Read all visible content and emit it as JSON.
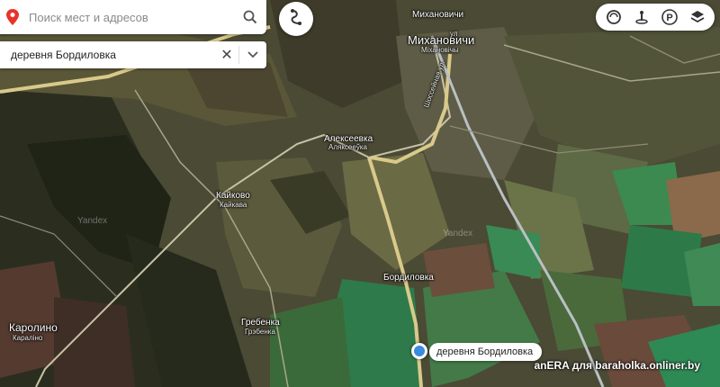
{
  "search": {
    "placeholder": "Поиск мест и адресов",
    "route_value": "деревня Бордиловка"
  },
  "colors": {
    "pin": "#e8332a",
    "marker": "#3b8bde",
    "road_major": "#d9c98a",
    "railway": "#b9c0c4"
  },
  "toolbar": {
    "icons": [
      "traffic-icon",
      "panorama-icon",
      "parking-icon",
      "layers-icon"
    ],
    "parking_letter": "P"
  },
  "places": {
    "mikhanovichi_top": "Михановичи",
    "mikhanovichi_big": "Михановичи",
    "mikhanovichi_by": "Міхановічы",
    "alekseevka": "Алексеевка",
    "alekseevka_by": "Аляксееўка",
    "kaykovo": "Кайково",
    "kaykovo_by": "Кайкава",
    "bordilovka": "Бордиловка",
    "grebenka": "Гребенка",
    "grebenka_by": "Грэбенка",
    "karolino": "Каролино",
    "karolino_by": "Каралiно",
    "street_top": "ул",
    "street_shosseynaya": "Шоссейная ул."
  },
  "marker": {
    "label": "деревня Бордиловка"
  },
  "watermark": "anERA для baraholka.onliner.by",
  "brand": "Yandex"
}
